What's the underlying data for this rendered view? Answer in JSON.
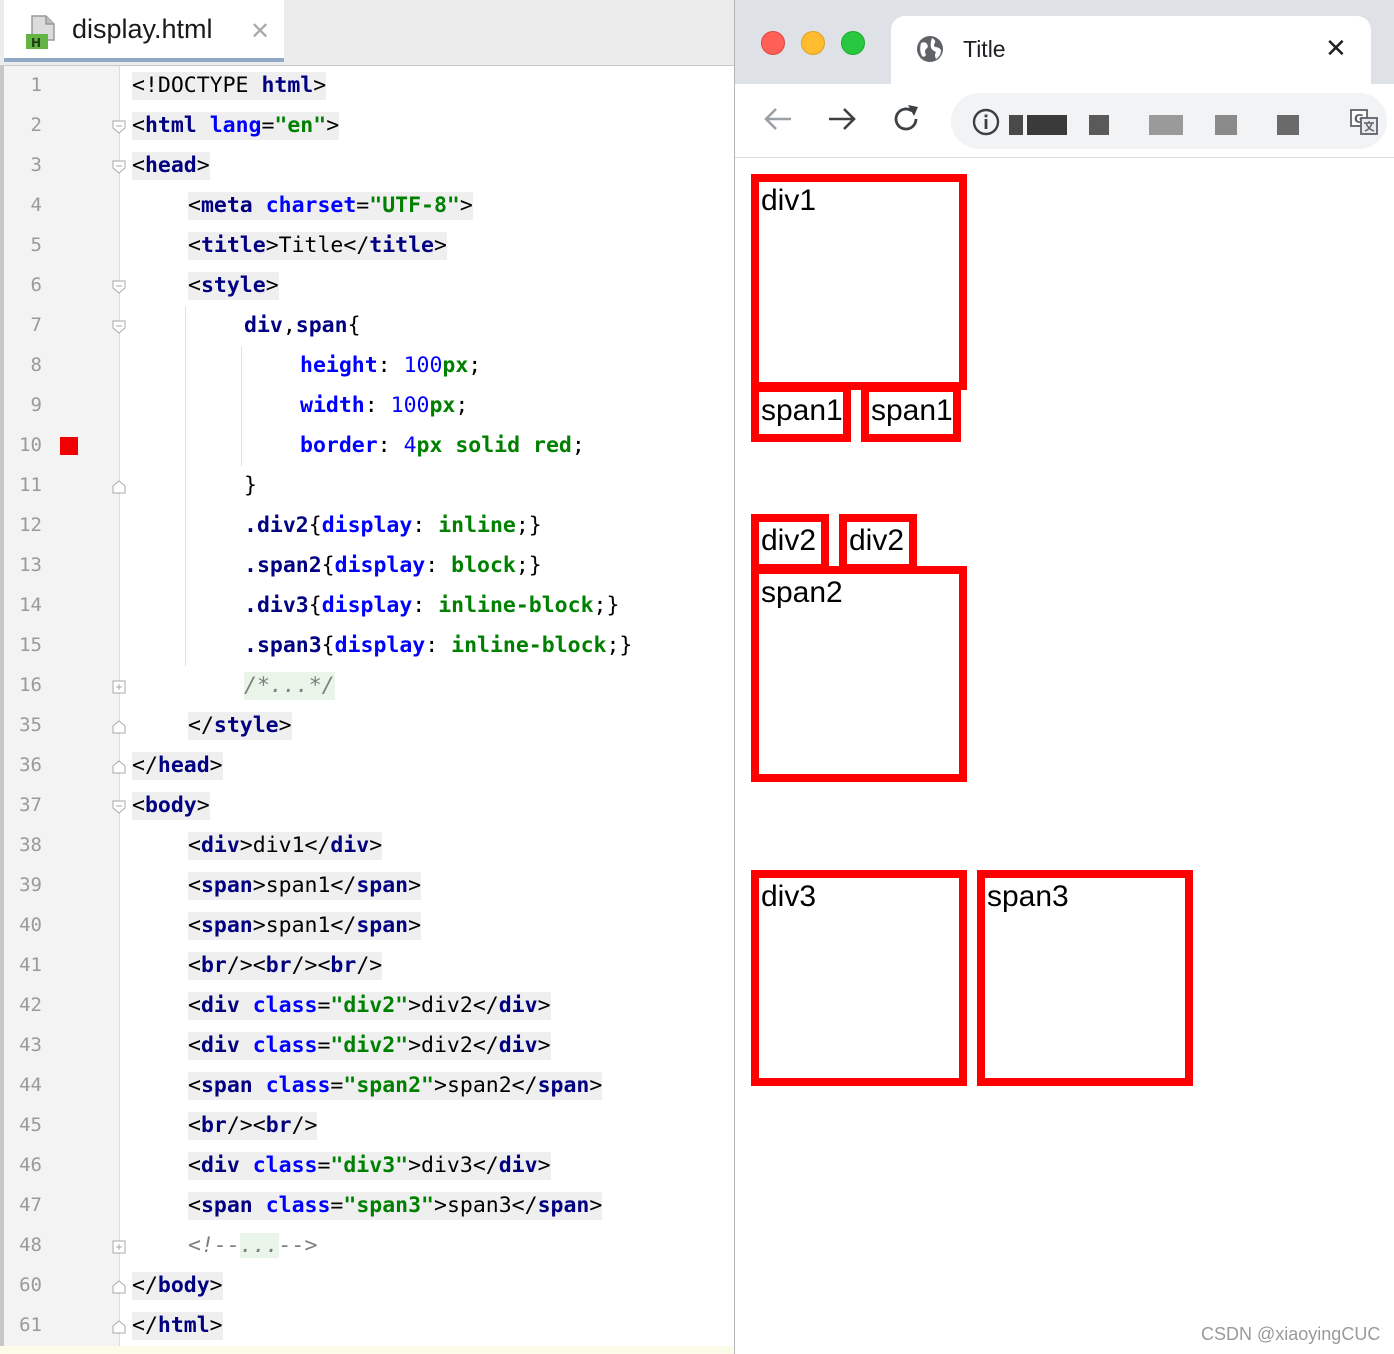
{
  "editor": {
    "tab": {
      "file_name": "display.html",
      "close": "✕",
      "icon": "html-file-icon"
    },
    "lines": [
      {
        "n": "1"
      },
      {
        "n": "2"
      },
      {
        "n": "3"
      },
      {
        "n": "4"
      },
      {
        "n": "5"
      },
      {
        "n": "6"
      },
      {
        "n": "7"
      },
      {
        "n": "8"
      },
      {
        "n": "9"
      },
      {
        "n": "10"
      },
      {
        "n": "11"
      },
      {
        "n": "12"
      },
      {
        "n": "13"
      },
      {
        "n": "14"
      },
      {
        "n": "15"
      },
      {
        "n": "16"
      },
      {
        "n": "35"
      },
      {
        "n": "36"
      },
      {
        "n": "37"
      },
      {
        "n": "38"
      },
      {
        "n": "39"
      },
      {
        "n": "40"
      },
      {
        "n": "41"
      },
      {
        "n": "42"
      },
      {
        "n": "43"
      },
      {
        "n": "44"
      },
      {
        "n": "45"
      },
      {
        "n": "46"
      },
      {
        "n": "47"
      },
      {
        "n": "48"
      },
      {
        "n": "60"
      },
      {
        "n": "61"
      }
    ],
    "code": {
      "l1_a": "<!DOCTYPE ",
      "l1_b": "html",
      "l1_c": ">",
      "l2_a": "<",
      "l2_b": "html ",
      "l2_c": "lang",
      "l2_d": "=",
      "l2_e": "\"en\"",
      "l2_f": ">",
      "l3_a": "<",
      "l3_b": "head",
      "l3_c": ">",
      "l4_a": "<",
      "l4_b": "meta ",
      "l4_c": "charset",
      "l4_d": "=",
      "l4_e": "\"UTF-8\"",
      "l4_f": ">",
      "l5_a": "<",
      "l5_b": "title",
      "l5_c": ">",
      "l5_d": "Title",
      "l5_e": "</",
      "l5_f": "title",
      "l5_g": ">",
      "l6_a": "<",
      "l6_b": "style",
      "l6_c": ">",
      "l7_a": "div",
      "l7_b": ",",
      "l7_c": "span",
      "l7_d": "{",
      "l8_a": "height",
      "l8_b": ": ",
      "l8_c": "100",
      "l8_d": "px",
      "l8_e": ";",
      "l9_a": "width",
      "l9_b": ": ",
      "l9_c": "100",
      "l9_d": "px",
      "l9_e": ";",
      "l10_a": "border",
      "l10_b": ": ",
      "l10_c": "4",
      "l10_d": "px solid red",
      "l10_e": ";",
      "l11_a": "}",
      "l12_a": ".div2",
      "l12_b": "{",
      "l12_c": "display",
      "l12_d": ": ",
      "l12_e": "inline",
      "l12_f": ";}",
      "l13_a": ".span2",
      "l13_b": "{",
      "l13_c": "display",
      "l13_d": ": ",
      "l13_e": "block",
      "l13_f": ";}",
      "l14_a": ".div3",
      "l14_b": "{",
      "l14_c": "display",
      "l14_d": ": ",
      "l14_e": "inline-block",
      "l14_f": ";}",
      "l15_a": ".span3",
      "l15_b": "{",
      "l15_c": "display",
      "l15_d": ": ",
      "l15_e": "inline-block",
      "l15_f": ";}",
      "l16_a": "/*...*/",
      "l35_a": "</",
      "l35_b": "style",
      "l35_c": ">",
      "l36_a": "</",
      "l36_b": "head",
      "l36_c": ">",
      "l37_a": "<",
      "l37_b": "body",
      "l37_c": ">",
      "l38_a": "<",
      "l38_b": "div",
      "l38_c": ">",
      "l38_d": "div1",
      "l38_e": "</",
      "l38_f": "div",
      "l38_g": ">",
      "l39_a": "<",
      "l39_b": "span",
      "l39_c": ">",
      "l39_d": "span1",
      "l39_e": "</",
      "l39_f": "span",
      "l39_g": ">",
      "l40_a": "<",
      "l40_b": "span",
      "l40_c": ">",
      "l40_d": "span1",
      "l40_e": "</",
      "l40_f": "span",
      "l40_g": ">",
      "l41_a": "<",
      "l41_b": "br",
      "l41_c": "/><",
      "l41_d": "br",
      "l41_e": "/><",
      "l41_f": "br",
      "l41_g": "/>",
      "l42_a": "<",
      "l42_b": "div ",
      "l42_c": "class",
      "l42_d": "=",
      "l42_e": "\"div2\"",
      "l42_f": ">",
      "l42_g": "div2",
      "l42_h": "</",
      "l42_i": "div",
      "l42_j": ">",
      "l43_a": "<",
      "l43_b": "div ",
      "l43_c": "class",
      "l43_d": "=",
      "l43_e": "\"div2\"",
      "l43_f": ">",
      "l43_g": "div2",
      "l43_h": "</",
      "l43_i": "div",
      "l43_j": ">",
      "l44_a": "<",
      "l44_b": "span ",
      "l44_c": "class",
      "l44_d": "=",
      "l44_e": "\"span2\"",
      "l44_f": ">",
      "l44_g": "span2",
      "l44_h": "</",
      "l44_i": "span",
      "l44_j": ">",
      "l45_a": "<",
      "l45_b": "br",
      "l45_c": "/><",
      "l45_d": "br",
      "l45_e": "/>",
      "l46_a": "<",
      "l46_b": "div ",
      "l46_c": "class",
      "l46_d": "=",
      "l46_e": "\"div3\"",
      "l46_f": ">",
      "l46_g": "div3",
      "l46_h": "</",
      "l46_i": "div",
      "l46_j": ">",
      "l47_a": "<",
      "l47_b": "span ",
      "l47_c": "class",
      "l47_d": "=",
      "l47_e": "\"span3\"",
      "l47_f": ">",
      "l47_g": "span3",
      "l47_h": "</",
      "l47_i": "span",
      "l47_j": ">",
      "l48_a": "<!--",
      "l48_b": "...",
      "l48_c": "-->",
      "l60_a": "</",
      "l60_b": "body",
      "l60_c": ">",
      "l61_a": "</",
      "l61_b": "html",
      "l61_c": ">"
    },
    "breakpoint_line": "10"
  },
  "browser": {
    "tab_title": "Title",
    "tab_close": "✕",
    "nav": {
      "back": "back-arrow-icon",
      "forward": "forward-arrow-icon",
      "reload": "reload-icon"
    },
    "omnibox": {
      "info": "info-icon",
      "translate": "translate-icon"
    },
    "page": {
      "div1": "div1",
      "span1_a": "span1",
      "span1_b": "span1",
      "div2_a": "div2",
      "div2_b": "div2",
      "span2": "span2",
      "div3": "div3",
      "span3": "span3"
    },
    "watermark": "CSDN @xiaoyingCUC"
  },
  "colors": {
    "box_border": "#ff0000",
    "tag": "#000080",
    "attr": "#0000ff",
    "string": "#008000",
    "titlebar": "#dee1e6"
  }
}
